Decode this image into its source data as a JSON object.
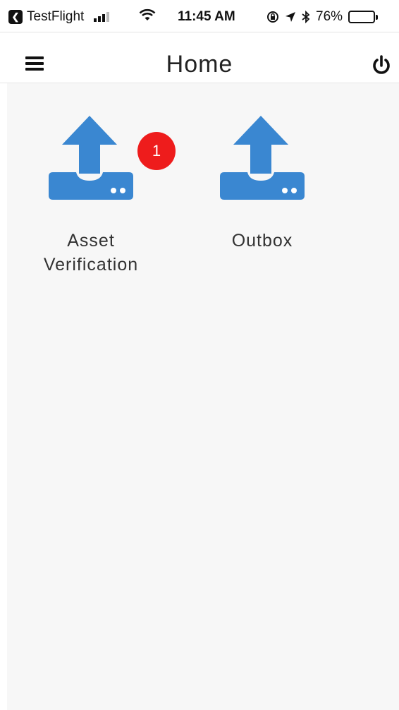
{
  "status_bar": {
    "back_app": "TestFlight",
    "time": "11:45 AM",
    "battery_percent": "76%",
    "battery_level": 0.76,
    "colors": {
      "battery_fill": "#38c23f"
    }
  },
  "header": {
    "title": "Home",
    "menu_icon": "hamburger-menu-icon",
    "power_icon": "power-icon"
  },
  "tiles": [
    {
      "label": "Asset Verification",
      "icon": "upload-tray-icon",
      "badge": "1"
    },
    {
      "label": "Outbox",
      "icon": "upload-tray-icon"
    }
  ],
  "colors": {
    "icon_blue": "#3a87d1",
    "badge_red": "#ee1c1c",
    "background": "#f7f7f7"
  }
}
